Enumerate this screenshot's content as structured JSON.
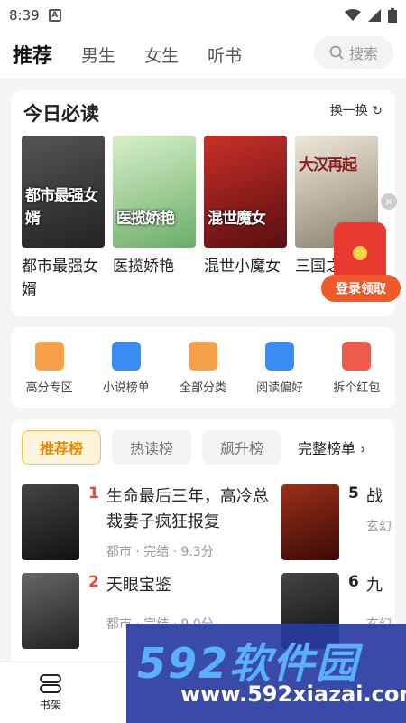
{
  "status": {
    "time": "8:39"
  },
  "nav": {
    "tabs": [
      "推荐",
      "男生",
      "女生",
      "听书"
    ],
    "search_label": "搜索"
  },
  "must_read": {
    "title": "今日必读",
    "refresh": "换一换",
    "books": [
      {
        "title": "都市最强女婿",
        "cover_text": "都市最强女婿",
        "color": "#3a3a3a"
      },
      {
        "title": "医揽娇艳",
        "cover_text": "医揽娇艳",
        "color": "#7bbf7a"
      },
      {
        "title": "混世小魔女",
        "cover_text": "混世魔女",
        "color": "#a01f20"
      },
      {
        "title": "三国之汉高",
        "cover_text": "大汉再起",
        "color": "#c8c0b0"
      }
    ]
  },
  "redpacket": {
    "button": "登录领取"
  },
  "categories": [
    {
      "label": "高分专区",
      "icon": "star-badge-icon",
      "color": "#f7a04a"
    },
    {
      "label": "小说榜单",
      "icon": "ranking-icon",
      "color": "#3a8cf0"
    },
    {
      "label": "全部分类",
      "icon": "grid-icon",
      "color": "#f7a04a"
    },
    {
      "label": "阅读偏好",
      "icon": "book-icon",
      "color": "#3a8cf0"
    },
    {
      "label": "拆个红包",
      "icon": "red-envelope-icon",
      "color": "#ef5a4a"
    }
  ],
  "ranking": {
    "tabs": [
      "推荐榜",
      "热读榜",
      "飙升榜"
    ],
    "full": "完整榜单 ›",
    "items": [
      {
        "rank": "1",
        "title": "生命最后三年，高冷总裁妻子疯狂报复",
        "meta": "都市 · 完结 · 9.3分",
        "color": "#222"
      },
      {
        "rank": "2",
        "title": "天眼宝鉴",
        "meta": "都市 · 完结 · 9.0分",
        "color": "#333"
      },
      {
        "rank": "5",
        "title": "战",
        "meta": "玄幻",
        "color": "#6a1a12"
      },
      {
        "rank": "6",
        "title": "九",
        "meta": "玄幻",
        "color": "#2a2a2a"
      }
    ]
  },
  "bottom": {
    "shelf": "书架"
  },
  "watermark": {
    "brand": "592软件园",
    "url": "www.592xiazai.com"
  }
}
